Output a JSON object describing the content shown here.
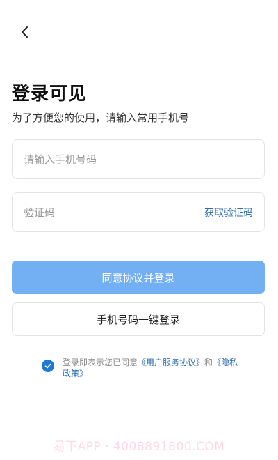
{
  "header": {
    "back_icon": "chevron-left-icon"
  },
  "title": "登录可见",
  "subtitle": "为了方便您的使用，请输入常用手机号",
  "phone_field": {
    "placeholder": "请输入手机号码",
    "value": ""
  },
  "code_field": {
    "placeholder": "验证码",
    "value": "",
    "get_code_label": "获取验证码"
  },
  "buttons": {
    "agree_login": "同意协议并登录",
    "one_click_login": "手机号码一键登录"
  },
  "agreement": {
    "prefix": "登录即表示您已同意",
    "user_agreement": "《用户服务协议》",
    "and": "和",
    "privacy_policy": "《隐私政策》",
    "checked": true
  },
  "watermark": "易下APP · 4008891800.COM",
  "colors": {
    "primary_button": "#73b0f3",
    "link": "#2f6fad",
    "checkbox": "#1f78d1",
    "watermark": "#ffd9e6"
  }
}
